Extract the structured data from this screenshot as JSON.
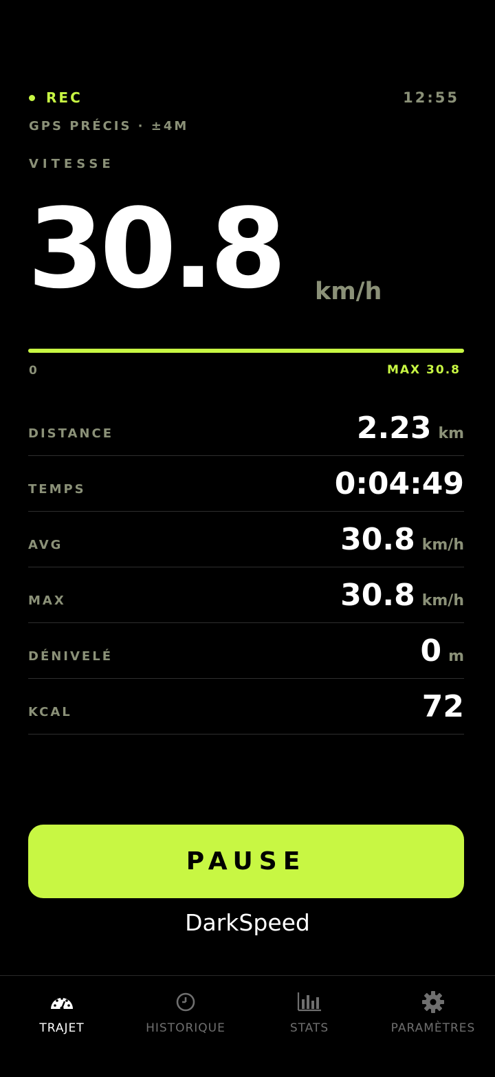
{
  "status": {
    "rec_label": "REC",
    "clock": "12:55",
    "gps": "GPS PRÉCIS · ±4M"
  },
  "speed": {
    "label": "VITESSE",
    "value": "30.8",
    "unit": "km/h",
    "progress_fraction": 1.0,
    "min_label": "0",
    "max_label": "MAX 30.8"
  },
  "stats": [
    {
      "label": "DISTANCE",
      "value": "2.23",
      "unit": "km"
    },
    {
      "label": "TEMPS",
      "value": "0:04:49",
      "unit": ""
    },
    {
      "label": "AVG",
      "value": "30.8",
      "unit": "km/h"
    },
    {
      "label": "MAX",
      "value": "30.8",
      "unit": "km/h"
    },
    {
      "label": "DÉNIVELÉ",
      "value": "0",
      "unit": "m"
    },
    {
      "label": "KCAL",
      "value": "72",
      "unit": ""
    }
  ],
  "pause_label": "PAUSE",
  "brand": "DarkSpeed",
  "tabs": [
    {
      "label": "TRAJET",
      "icon": "speedometer-icon",
      "active": true
    },
    {
      "label": "HISTORIQUE",
      "icon": "clock-icon",
      "active": false
    },
    {
      "label": "STATS",
      "icon": "bar-chart-icon",
      "active": false
    },
    {
      "label": "PARAMÈTRES",
      "icon": "gear-icon",
      "active": false
    }
  ],
  "colors": {
    "accent": "#c8f743",
    "muted": "#8b9178",
    "background": "#000000",
    "tab_inactive": "#6f6f6f"
  }
}
